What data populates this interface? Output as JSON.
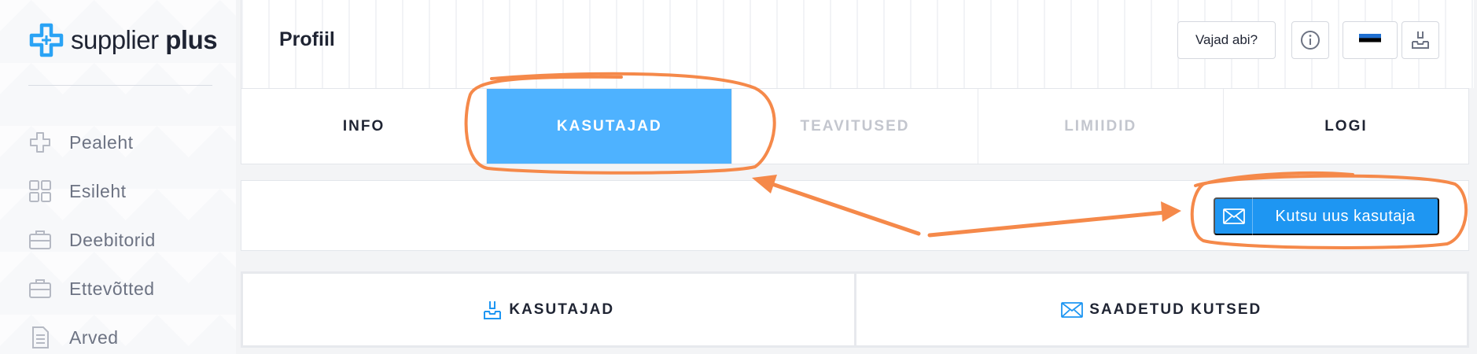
{
  "brand": {
    "name_light": "supplier",
    "name_bold": "plus"
  },
  "sidebar": {
    "items": [
      {
        "label": "Pealeht",
        "icon": "plus-cross-icon"
      },
      {
        "label": "Esileht",
        "icon": "grid-icon"
      },
      {
        "label": "Deebitorid",
        "icon": "briefcase-icon"
      },
      {
        "label": "Ettevõtted",
        "icon": "briefcase-icon"
      },
      {
        "label": "Arved",
        "icon": "document-icon"
      }
    ]
  },
  "header": {
    "title": "Profiil",
    "help_label": "Vajad abi?",
    "info_icon": "info-icon",
    "language_icon": "estonia-flag-icon",
    "logout_icon": "logout-tray-icon"
  },
  "tabs": [
    {
      "label": "INFO",
      "state": "normal"
    },
    {
      "label": "KASUTAJAD",
      "state": "active"
    },
    {
      "label": "TEAVITUSED",
      "state": "disabled"
    },
    {
      "label": "LIMIIDID",
      "state": "disabled"
    },
    {
      "label": "LOGI",
      "state": "normal"
    }
  ],
  "actions": {
    "invite_label": "Kutsu uus kasutaja",
    "invite_icon": "envelope-icon"
  },
  "subtabs": [
    {
      "label": "KASUTAJAD",
      "icon": "user-tray-icon"
    },
    {
      "label": "SAADETUD KUTSED",
      "icon": "envelope-icon"
    }
  ],
  "colors": {
    "accent": "#1e96f2",
    "active_tab": "#4eb2ff",
    "annotation": "#f5894a",
    "text_dark": "#1f2433",
    "text_muted": "#6d7383"
  }
}
